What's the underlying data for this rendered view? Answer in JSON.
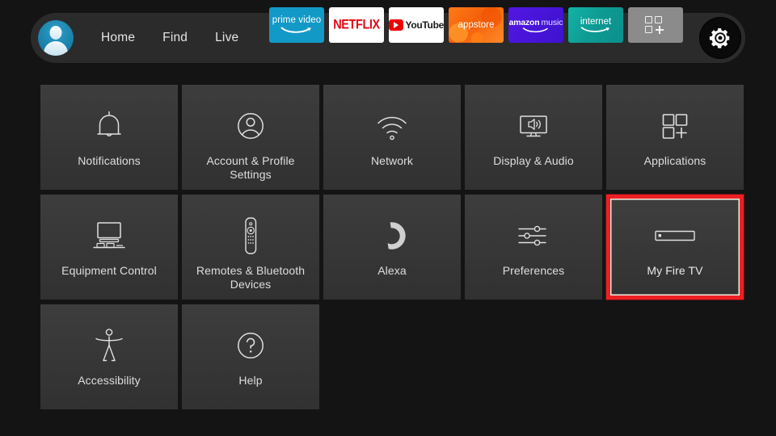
{
  "theme": {
    "page_background": "#141414",
    "topbar_background": "#2b2b2b",
    "tile_background": "#383838",
    "tile_label_color": "#dedede",
    "focus_border_color": "#ec2024",
    "avatar_color": "#1b82ab"
  },
  "topbar": {
    "avatar_name": "profile-avatar",
    "nav": [
      {
        "label": "Home"
      },
      {
        "label": "Find"
      },
      {
        "label": "Live"
      }
    ],
    "apps": [
      {
        "name": "prime-video",
        "label": "prime video",
        "icon": "prime-video-icon",
        "color": "#1399c6"
      },
      {
        "name": "netflix",
        "label": "NETFLIX",
        "icon": "netflix-icon",
        "color": "#e10914"
      },
      {
        "name": "youtube",
        "label": "YouTube",
        "icon": "youtube-icon",
        "color": "#ef0000"
      },
      {
        "name": "appstore",
        "label": "appstore",
        "icon": "appstore-icon",
        "color": "#f4600a"
      },
      {
        "name": "amazon-music",
        "label_bold": "amazon",
        "label_light": "music",
        "icon": "amazon-music-icon",
        "color": "#4615d8"
      },
      {
        "name": "internet",
        "label": "internet",
        "icon": "internet-icon",
        "color": "#0e9a93"
      },
      {
        "name": "apps-grid",
        "label": "",
        "icon": "apps-grid-plus-icon",
        "color": "#8b8b8b"
      }
    ],
    "settings_button": {
      "name": "settings-gear",
      "icon": "gear-icon",
      "selected": true
    }
  },
  "settings_grid": {
    "tiles": [
      {
        "id": "notifications",
        "label": "Notifications",
        "icon": "bell-icon",
        "focused": false
      },
      {
        "id": "account-profile-settings",
        "label": "Account & Profile Settings",
        "icon": "person-circle-icon",
        "focused": false
      },
      {
        "id": "network",
        "label": "Network",
        "icon": "wifi-icon",
        "focused": false
      },
      {
        "id": "display-audio",
        "label": "Display & Audio",
        "icon": "tv-speaker-icon",
        "focused": false
      },
      {
        "id": "applications",
        "label": "Applications",
        "icon": "apps-grid-plus-icon",
        "focused": false
      },
      {
        "id": "equipment-control",
        "label": "Equipment Control",
        "icon": "tv-devices-icon",
        "focused": false
      },
      {
        "id": "remotes-bluetooth-devices",
        "label": "Remotes & Bluetooth Devices",
        "icon": "remote-control-icon",
        "focused": false
      },
      {
        "id": "alexa",
        "label": "Alexa",
        "icon": "alexa-ring-icon",
        "focused": false
      },
      {
        "id": "preferences",
        "label": "Preferences",
        "icon": "sliders-icon",
        "focused": false
      },
      {
        "id": "my-fire-tv",
        "label": "My Fire TV",
        "icon": "fire-tv-stick-icon",
        "focused": true
      },
      {
        "id": "accessibility",
        "label": "Accessibility",
        "icon": "accessibility-person-icon",
        "focused": false
      },
      {
        "id": "help",
        "label": "Help",
        "icon": "question-circle-icon",
        "focused": false
      }
    ]
  }
}
